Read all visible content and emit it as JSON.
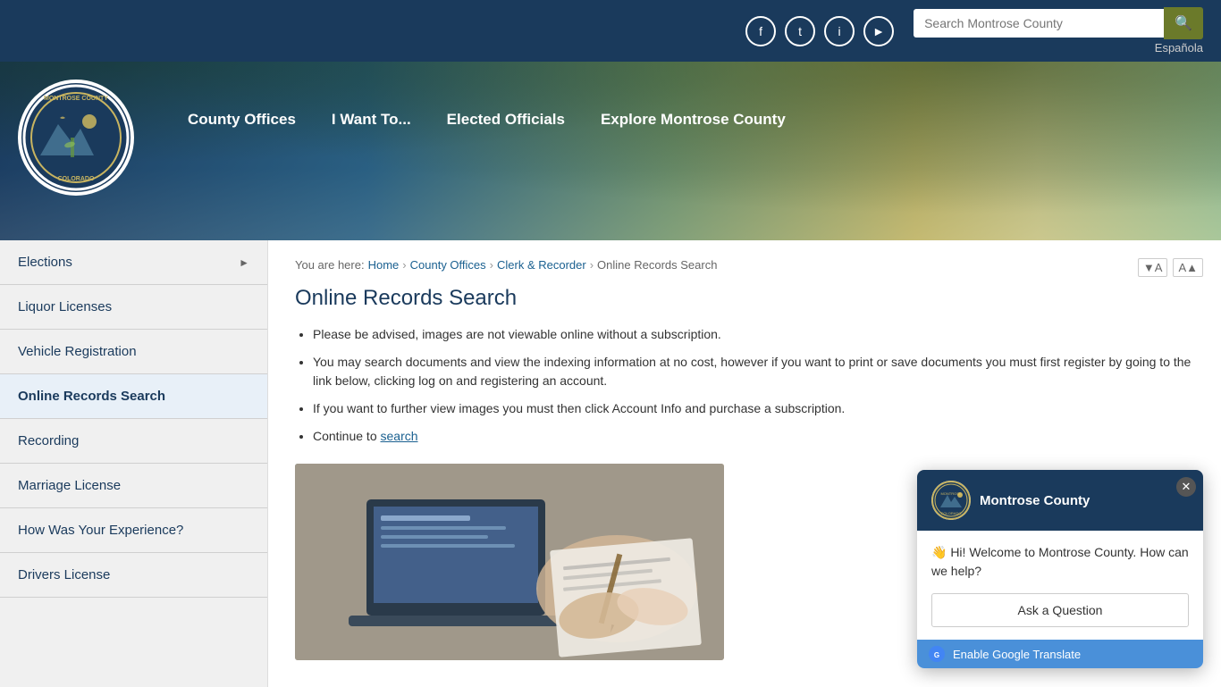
{
  "site": {
    "name": "Montrose County",
    "logo_alt": "Montrose County Colorado seal"
  },
  "header": {
    "search_placeholder": "Search Montrose County",
    "espanola_label": "Española",
    "social": [
      {
        "name": "facebook",
        "icon": "f"
      },
      {
        "name": "twitter",
        "icon": "t"
      },
      {
        "name": "instagram",
        "icon": "i"
      },
      {
        "name": "youtube",
        "icon": "▶"
      }
    ],
    "nav": [
      {
        "label": "County Offices",
        "id": "county-offices"
      },
      {
        "label": "I Want To...",
        "id": "i-want-to"
      },
      {
        "label": "Elected Officials",
        "id": "elected-officials"
      },
      {
        "label": "Explore Montrose County",
        "id": "explore"
      }
    ]
  },
  "breadcrumb": {
    "items": [
      {
        "label": "Home",
        "href": "#"
      },
      {
        "label": "County Offices",
        "href": "#"
      },
      {
        "label": "Clerk & Recorder",
        "href": "#"
      },
      {
        "label": "Online Records Search",
        "href": null
      }
    ]
  },
  "page": {
    "title": "Online Records Search",
    "bullets": [
      "Please be advised, images are not viewable online without a subscription.",
      "You may search documents and view the indexing information at no cost, however if you want to print or save documents you must first register by going to the link below, clicking log on and registering an account.",
      "If you want to further view images you must then click Account Info and purchase a subscription.",
      "Continue to search"
    ],
    "search_link_text": "search"
  },
  "sidebar": {
    "items": [
      {
        "label": "Elections",
        "id": "elections",
        "has_arrow": true
      },
      {
        "label": "Liquor Licenses",
        "id": "liquor-licenses",
        "has_arrow": false
      },
      {
        "label": "Vehicle Registration",
        "id": "vehicle-registration",
        "has_arrow": false
      },
      {
        "label": "Online Records Search",
        "id": "online-records-search",
        "has_arrow": false,
        "active": true
      },
      {
        "label": "Recording",
        "id": "recording",
        "has_arrow": false
      },
      {
        "label": "Marriage License",
        "id": "marriage-license",
        "has_arrow": false
      },
      {
        "label": "How Was Your Experience?",
        "id": "how-was-your-experience",
        "has_arrow": false
      },
      {
        "label": "Drivers License",
        "id": "drivers-license",
        "has_arrow": false
      }
    ]
  },
  "chat_widget": {
    "title": "Montrose County",
    "greeting": "👋 Hi! Welcome to Montrose County. How can we help?",
    "ask_button": "Ask a Question",
    "translate_label": "Enable Google Translate"
  },
  "font_controls": {
    "decrease": "▼A",
    "increase": "A▲"
  }
}
